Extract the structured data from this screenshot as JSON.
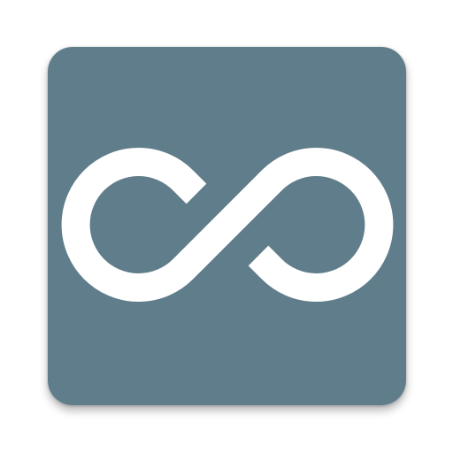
{
  "icon": {
    "name": "infinity-icon",
    "background_color": "#607d8b",
    "glyph_color": "#ffffff"
  }
}
